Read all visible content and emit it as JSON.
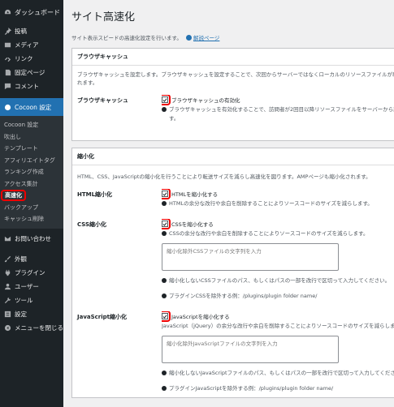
{
  "sidebar": {
    "dashboard": "ダッシュボード",
    "items_top": [
      {
        "label": "投稿",
        "icon": "pin-icon"
      },
      {
        "label": "メディア",
        "icon": "media-icon"
      },
      {
        "label": "リンク",
        "icon": "link-icon"
      },
      {
        "label": "固定ページ",
        "icon": "page-icon"
      },
      {
        "label": "コメント",
        "icon": "comment-icon"
      }
    ],
    "cocoon": "Cocoon 設定",
    "submenu": [
      "Cocoon 設定",
      "吹出し",
      "テンプレート",
      "アフィリエイトタグ",
      "ランキング作成",
      "アクセス集計",
      "高速化",
      "バックアップ",
      "キャッシュ削除"
    ],
    "contact": "お問い合わせ",
    "items_bottom": [
      {
        "label": "外観",
        "icon": "brush-icon"
      },
      {
        "label": "プラグイン",
        "icon": "plugin-icon"
      },
      {
        "label": "ユーザー",
        "icon": "user-icon"
      },
      {
        "label": "ツール",
        "icon": "wrench-icon"
      },
      {
        "label": "設定",
        "icon": "settings-icon"
      }
    ],
    "collapse": "メニューを閉じる"
  },
  "main": {
    "title": "サイト高速化",
    "description": "サイト表示スピードの高速化設定を行います。",
    "help_link": "解説ページ",
    "browser_cache": {
      "heading": "ブラウザキャッシュ",
      "intro": "ブラウザキャッシュを設定します。ブラウザキャッシュを設定することで、次回からサーバーではなくローカルのリソースファイルが利用されます。",
      "intro2": "れます。",
      "label": "ブラウザキャッシュ",
      "checkbox": "ブラウザキャッシュの有効化",
      "note": "ブラウザキャッシュを有効化することで、訪問者が2回目以降リソースファイルをサーバーから読み込まなくてよくなりま",
      "note2": "す。"
    },
    "minify": {
      "heading": "縮小化",
      "intro": "HTML、CSS、JavaScriptの縮小化を行うことにより転送サイズを減らし高速化を図ります。AMPページも縮小化されます。",
      "html_label": "HTML縮小化",
      "html_checkbox": "HTMLを縮小化する",
      "html_note": "HTMLの余分な改行や余白を削除することによりソースコードのサイズを減らします。",
      "css_label": "CSS縮小化",
      "css_checkbox": "CSSを縮小化する",
      "css_note": "CSSの余分な改行や余白を削除することによりソースコードのサイズを減らします。",
      "css_textarea_placeholder": "縮小化除外CSSファイルの文字列を入力",
      "css_exclude_note": "縮小化しないCSSファイルのパス、もしくはパスの一部を改行で区切って入力してください。",
      "css_plugin_note": "プラグインCSSを除外する例：/plugins/plugin folder name/",
      "js_label": "JavaScript縮小化",
      "js_checkbox": "JavaScriptを縮小化する",
      "js_note": "JavaScript（jQuery）の余分な改行や余白を削除することによりソースコードのサイズを減らします。",
      "js_textarea_placeholder": "縮小化除外JavaScriptファイルの文字列を入力",
      "js_exclude_note": "縮小化しないJavaScriptファイルのパス、もしくはパスの一部を改行で区切って入力してください。",
      "js_plugin_note": "プラグインJavaScriptを除外する例：/plugins/plugin folder name/"
    }
  },
  "colors": {
    "sidebar_bg": "#1d2327",
    "accent": "#2271b1",
    "highlight": "#e00000"
  }
}
